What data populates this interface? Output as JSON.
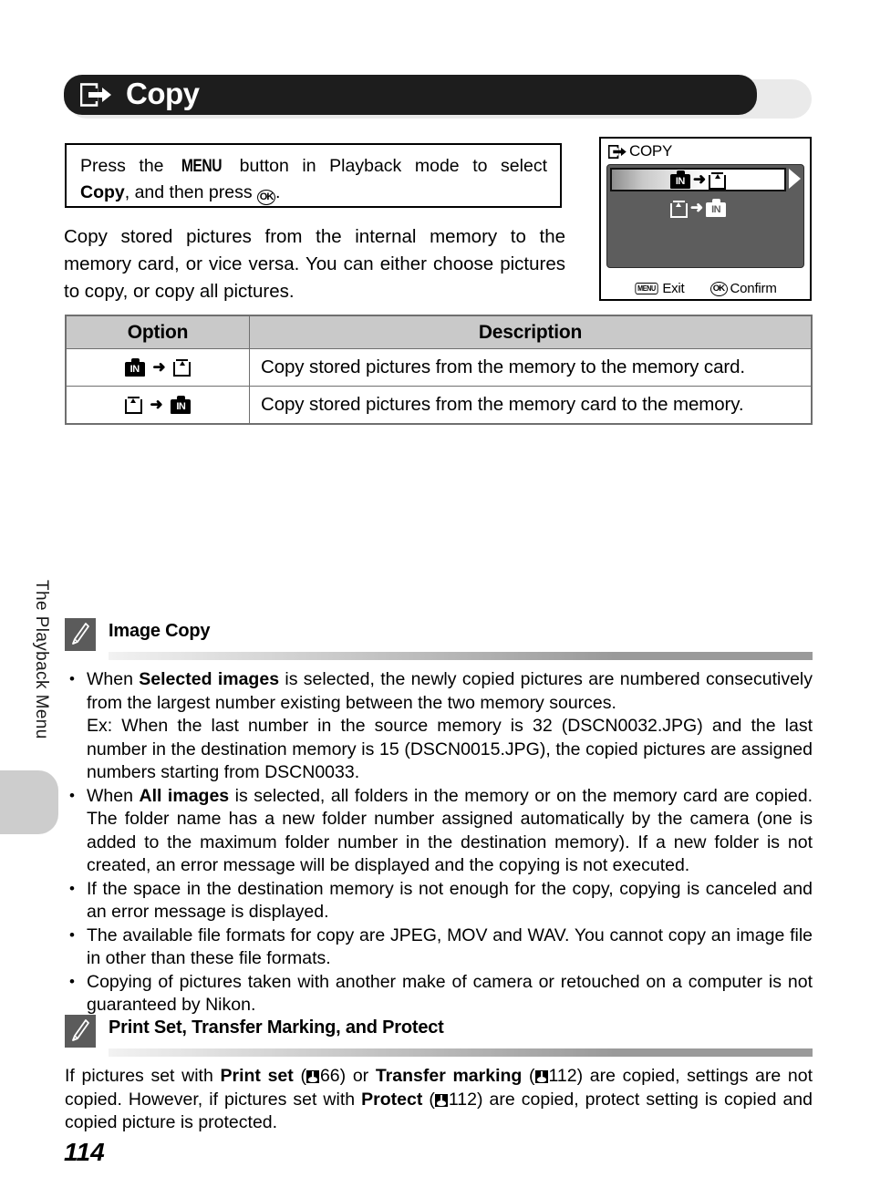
{
  "chapter_tab": {
    "label": "The Playback Menu"
  },
  "header": {
    "title": "Copy",
    "icon": "copy-icon"
  },
  "instruction_box": {
    "text_part1": "Press the ",
    "menu_button": "MENU",
    "text_part2": " button in Playback mode to select ",
    "bold_copy": "Copy",
    "text_part3": ", and then press ",
    "ok_button": "OK",
    "text_part4": "."
  },
  "intro_paragraph": "Copy stored pictures from the internal memory to the memory card, or vice versa. You can either choose pictures to copy, or copy all pictures.",
  "lcd": {
    "title": "COPY",
    "title_icon": "copy-icon",
    "rows": [
      {
        "from": "IN",
        "to": "card",
        "selected": true
      },
      {
        "from": "card",
        "to": "IN",
        "selected": false
      }
    ],
    "footer": [
      {
        "badge": "MENU",
        "label": "Exit"
      },
      {
        "badge": "OK",
        "label": "Confirm"
      }
    ]
  },
  "table": {
    "headers": [
      "Option",
      "Description"
    ],
    "rows": [
      {
        "option_from": "IN",
        "option_to": "card",
        "description": "Copy stored pictures from the memory to the memory card."
      },
      {
        "option_from": "card",
        "option_to": "IN",
        "description": "Copy stored pictures from the memory card to the memory."
      }
    ]
  },
  "notes": [
    {
      "icon": "pencil-icon",
      "title": "Image Copy",
      "bullets": [
        {
          "lead": "When ",
          "bold": "Selected images",
          "rest": " is selected, the newly copied pictures are numbered consecutively from the largest number existing between the two memory sources.",
          "example_label": "Ex: ",
          "example": "When the last number in the source memory is 32 (DSCN0032.JPG) and the last number in the destination memory is 15 (DSCN0015.JPG), the copied pictures are assigned numbers starting from DSCN0033."
        },
        {
          "lead": "When ",
          "bold": "All images",
          "rest": " is selected, all folders in the memory or on the memory card are copied. The folder name has a new folder number assigned automatically by the camera (one is added to the maximum folder number in the destination memory). If a new folder is not created, an error message will be displayed and the copying is not executed."
        },
        {
          "lead": "If the space in the destination memory is not enough for the copy, copying is canceled and an error message is displayed."
        },
        {
          "lead": "The available file formats for copy are JPEG, MOV and WAV. You cannot copy an image file in other than these file formats."
        },
        {
          "lead": "Copying of pictures taken with another make of camera or retouched on a computer is not guaranteed by Nikon."
        }
      ]
    },
    {
      "icon": "pencil-icon",
      "title": "Print Set, Transfer Marking, and Protect",
      "paragraph": {
        "p1": "If pictures set with ",
        "b1": "Print set",
        "p2": " (",
        "ref1": "66",
        "p3": ") or ",
        "b2": "Transfer marking",
        "p4": " (",
        "ref2": "112",
        "p5": ") are copied, settings are not copied. However, if pictures set with ",
        "b3": "Protect",
        "p6": " (",
        "ref3": "112",
        "p7": ") are copied, protect setting is copied and copied picture is protected."
      }
    }
  ],
  "page_number": "114",
  "colors": {
    "header_bar": "#1d1d1d",
    "header_backplate": "#eaeaea",
    "table_header": "#c9c9c9",
    "table_border": "#6f6f6f",
    "lcd_screen": "#5d5d5d",
    "note_icon": "#5b5b5b",
    "side_tab": "#cdcdcd"
  }
}
